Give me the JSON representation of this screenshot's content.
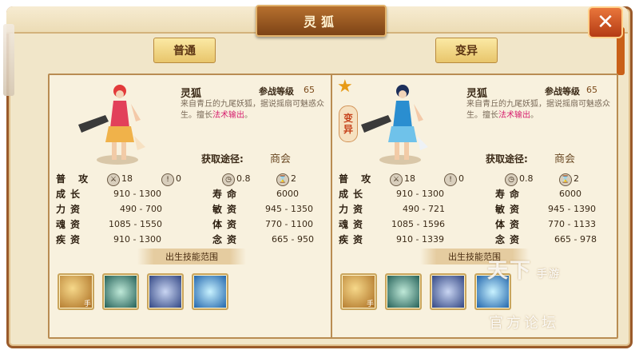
{
  "window": {
    "title": "灵狐",
    "close_label": "✕"
  },
  "tabs": [
    "普通",
    "变异"
  ],
  "panels": [
    {
      "name": "灵狐",
      "level_label": "参战等级",
      "level": "65",
      "desc_pre": "来自青丘的九尾妖狐，据说摇扇可魅惑众生。擅长",
      "desc_hl": "法术输出",
      "desc_post": "。",
      "source_label": "获取途径:",
      "source": "商会",
      "attack_label": "普 攻",
      "icons": [
        {
          "name": "sword-icon",
          "glyph": "⚔",
          "value": "18"
        },
        {
          "name": "exclaim-icon",
          "glyph": "!",
          "value": "0"
        },
        {
          "name": "clock-icon",
          "glyph": "◷",
          "value": "0.8"
        },
        {
          "name": "hourglass-icon",
          "glyph": "⌛",
          "value": "2"
        }
      ],
      "stats_left": [
        {
          "label": "成长",
          "value": "910 - 1300"
        },
        {
          "label": "力资",
          "value": "490 - 700"
        },
        {
          "label": "魂资",
          "value": "1085 - 1550"
        },
        {
          "label": "疾资",
          "value": "910 - 1300"
        }
      ],
      "stats_right": [
        {
          "label": "寿命",
          "value": "6000"
        },
        {
          "label": "敏资",
          "value": "945 - 1350"
        },
        {
          "label": "体资",
          "value": "770 - 1100"
        },
        {
          "label": "念资",
          "value": "665 - 950"
        }
      ],
      "skill_banner": "出生技能范围"
    },
    {
      "name": "灵狐",
      "level_label": "参战等级",
      "level": "65",
      "variant_tag": [
        "变",
        "异"
      ],
      "desc_pre": "来自青丘的九尾妖狐，据说摇扇可魅惑众生。擅长",
      "desc_hl": "法术输出",
      "desc_post": "。",
      "source_label": "获取途径:",
      "source": "商会",
      "attack_label": "普 攻",
      "icons": [
        {
          "name": "sword-icon",
          "glyph": "⚔",
          "value": "18"
        },
        {
          "name": "exclaim-icon",
          "glyph": "!",
          "value": "0"
        },
        {
          "name": "clock-icon",
          "glyph": "◷",
          "value": "0.8"
        },
        {
          "name": "hourglass-icon",
          "glyph": "⌛",
          "value": "2"
        }
      ],
      "stats_left": [
        {
          "label": "成长",
          "value": "910 - 1300"
        },
        {
          "label": "力资",
          "value": "490 - 721"
        },
        {
          "label": "魂资",
          "value": "1085 - 1596"
        },
        {
          "label": "疾资",
          "value": "910 - 1339"
        }
      ],
      "stats_right": [
        {
          "label": "寿命",
          "value": "6000"
        },
        {
          "label": "敏资",
          "value": "945 - 1390"
        },
        {
          "label": "体资",
          "value": "770 - 1133"
        },
        {
          "label": "念资",
          "value": "665 - 978"
        }
      ],
      "skill_banner": "出生技能范围"
    }
  ],
  "skill_hand_label": "手",
  "watermark": {
    "main": "天下",
    "sub": "手游",
    "bottom": "官方论坛"
  },
  "colors": {
    "frame": "#9a5a2a",
    "accent": "#d61f6e",
    "close": "#c24a1c"
  }
}
